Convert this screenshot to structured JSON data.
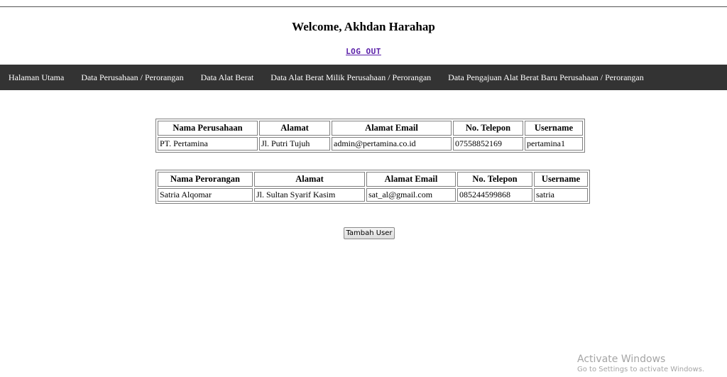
{
  "header": {
    "welcome": "Welcome, Akhdan Harahap",
    "logout": "LOG OUT"
  },
  "nav": {
    "items": [
      "Halaman Utama",
      "Data Perusahaan / Perorangan",
      "Data Alat Berat",
      "Data Alat Berat Milik Perusahaan / Perorangan",
      "Data Pengajuan Alat Berat Baru Perusahaan / Perorangan"
    ]
  },
  "company_table": {
    "headers": [
      "Nama Perusahaan",
      "Alamat",
      "Alamat Email",
      "No. Telepon",
      "Username"
    ],
    "rows": [
      [
        "PT. Pertamina",
        "Jl. Putri Tujuh",
        "admin@pertamina.co.id",
        "07558852169",
        "pertamina1"
      ]
    ]
  },
  "person_table": {
    "headers": [
      "Nama Perorangan",
      "Alamat",
      "Alamat Email",
      "No. Telepon",
      "Username"
    ],
    "rows": [
      [
        "Satria Alqomar",
        "Jl. Sultan Syarif Kasim",
        "sat_al@gmail.com",
        "085244599868",
        "satria"
      ]
    ]
  },
  "actions": {
    "add_user": "Tambah User"
  },
  "watermark": {
    "line1": "Activate Windows",
    "line2": "Go to Settings to activate Windows."
  },
  "colors": {
    "navbar_bg": "#333333",
    "logout_link": "#5a1fa8",
    "watermark": "#a5a5a5"
  }
}
